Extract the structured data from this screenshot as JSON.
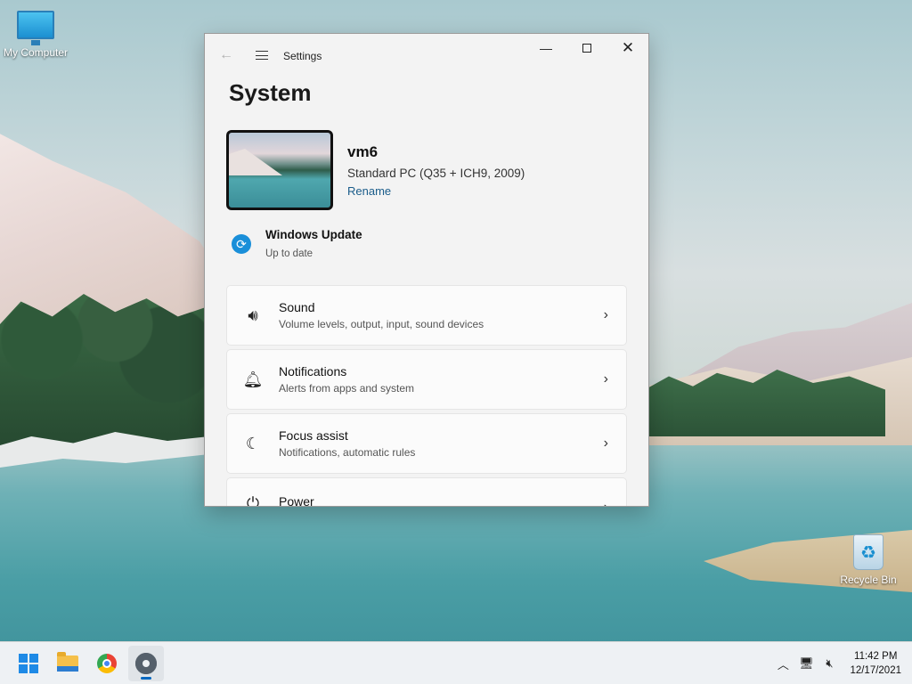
{
  "desktop": {
    "icons": [
      {
        "label": "My Computer"
      },
      {
        "label": "Recycle Bin"
      }
    ]
  },
  "window": {
    "app_title": "Settings",
    "page_title": "System",
    "device": {
      "name": "vm6",
      "model": "Standard PC (Q35 + ICH9, 2009)",
      "rename_label": "Rename"
    },
    "windows_update": {
      "title": "Windows Update",
      "status": "Up to date"
    },
    "items": [
      {
        "title": "Sound",
        "desc": "Volume levels, output, input, sound devices",
        "icon": "speaker-icon"
      },
      {
        "title": "Notifications",
        "desc": "Alerts from apps and system",
        "icon": "bell-icon"
      },
      {
        "title": "Focus assist",
        "desc": "Notifications, automatic rules",
        "icon": "moon-icon"
      },
      {
        "title": "Power",
        "desc": "",
        "icon": "power-icon"
      }
    ]
  },
  "taskbar": {
    "clock": {
      "time": "11:42 PM",
      "date": "12/17/2021"
    }
  },
  "colors": {
    "accent": "#0067c0",
    "link": "#1a5c8a",
    "update_icon": "#1a8fd9"
  }
}
